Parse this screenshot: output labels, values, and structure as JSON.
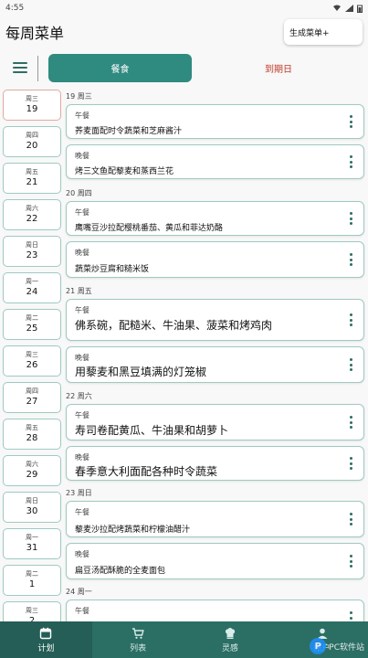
{
  "statusbar": {
    "time": "4:55"
  },
  "header": {
    "title": "每周菜单",
    "generate_label": "生成菜单+"
  },
  "tabs": {
    "active": "餐食",
    "other": "到期日"
  },
  "days": [
    {
      "wd": "周三",
      "num": "19",
      "selected": true
    },
    {
      "wd": "周四",
      "num": "20"
    },
    {
      "wd": "周五",
      "num": "21"
    },
    {
      "wd": "周六",
      "num": "22"
    },
    {
      "wd": "周日",
      "num": "23"
    },
    {
      "wd": "周一",
      "num": "24"
    },
    {
      "wd": "周二",
      "num": "25"
    },
    {
      "wd": "周三",
      "num": "26"
    },
    {
      "wd": "周四",
      "num": "27"
    },
    {
      "wd": "周五",
      "num": "28"
    },
    {
      "wd": "周六",
      "num": "29"
    },
    {
      "wd": "周日",
      "num": "30"
    },
    {
      "wd": "周一",
      "num": "31"
    },
    {
      "wd": "周二",
      "num": "1"
    },
    {
      "wd": "周三",
      "num": "2"
    }
  ],
  "sections": [
    {
      "label": "19 周三"
    },
    {
      "label": "20 周四"
    },
    {
      "label": "21 周五"
    },
    {
      "label": "22 周六"
    },
    {
      "label": "23 周日"
    },
    {
      "label": "24 周一"
    }
  ],
  "meals": [
    {
      "label": "午餐",
      "dish": "荞麦面配时令蔬菜和芝麻酱汁"
    },
    {
      "label": "晚餐",
      "dish": "烤三文鱼配藜麦和蒸西兰花"
    },
    {
      "label": "午餐",
      "dish": "鹰嘴豆沙拉配樱桃番茄、黄瓜和菲达奶酪"
    },
    {
      "label": "晚餐",
      "dish": "蔬菜炒豆腐和糙米饭"
    },
    {
      "label": "午餐",
      "dish": "佛系碗，配糙米、牛油果、菠菜和烤鸡肉"
    },
    {
      "label": "晚餐",
      "dish": "用藜麦和黑豆填满的灯笼椒"
    },
    {
      "label": "午餐",
      "dish": "寿司卷配黄瓜、牛油果和胡萝卜"
    },
    {
      "label": "晚餐",
      "dish": "春季意大利面配各种时令蔬菜"
    },
    {
      "label": "午餐",
      "dish": "藜麦沙拉配烤蔬菜和柠檬油醋汁"
    },
    {
      "label": "晚餐",
      "dish": "扁豆汤配酥脆的全麦面包"
    },
    {
      "label": "午餐",
      "dish": ""
    }
  ],
  "nav": [
    {
      "label": "计划",
      "icon": "calendar-icon"
    },
    {
      "label": "列表",
      "icon": "cart-icon"
    },
    {
      "label": "灵感",
      "icon": "chef-hat-icon"
    },
    {
      "label": "账户",
      "icon": "user-icon"
    }
  ],
  "watermark": {
    "text": "PC软件站"
  },
  "colors": {
    "primary": "#2f8a80",
    "nav": "#2b6e64",
    "accent_red": "#c0392b",
    "card_border": "#9fc9c2"
  }
}
